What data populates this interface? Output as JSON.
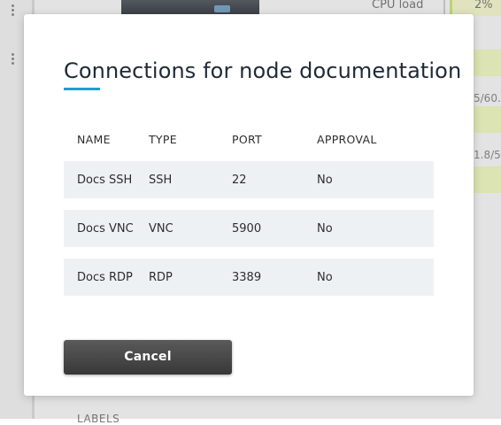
{
  "background": {
    "cpu_label": "CPU load",
    "cpu_value": "2%",
    "side_value_1": "5/60.",
    "side_value_2": "1.8/5",
    "bottom_label": "LABELS"
  },
  "modal": {
    "title": "Connections for node documentation",
    "table": {
      "headers": {
        "name": "NAME",
        "type": "TYPE",
        "port": "PORT",
        "approval": "APPROVAL"
      },
      "rows": [
        {
          "name": "Docs SSH",
          "type": "SSH",
          "port": "22",
          "approval": "No"
        },
        {
          "name": "Docs VNC",
          "type": "VNC",
          "port": "5900",
          "approval": "No"
        },
        {
          "name": "Docs RDP",
          "type": "RDP",
          "port": "3389",
          "approval": "No"
        }
      ]
    },
    "cancel_label": "Cancel"
  },
  "colors": {
    "accent": "#1e9fd3",
    "button_dark": "#3c3c3c",
    "row_background": "#eef1f4",
    "background_green": "#eef8c2"
  }
}
